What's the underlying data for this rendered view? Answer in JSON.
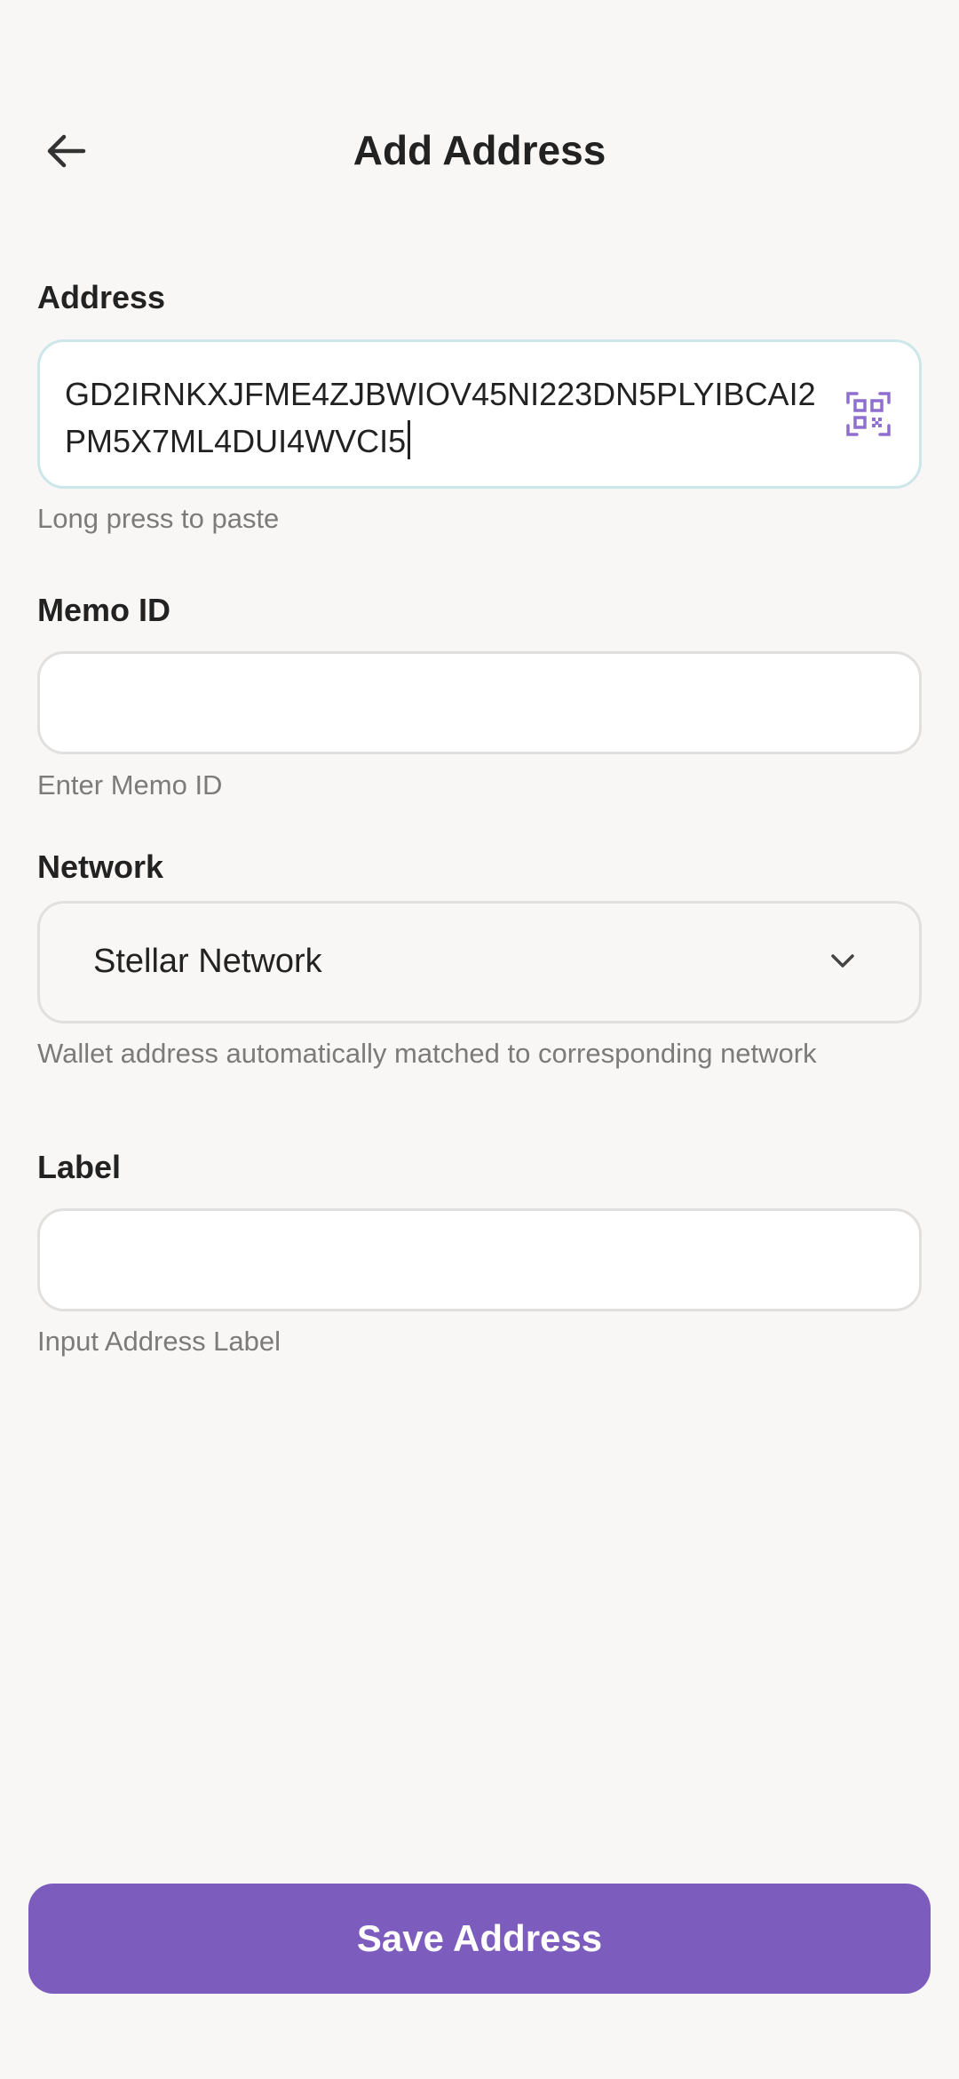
{
  "header": {
    "title": "Add Address",
    "back_icon": "arrow-left-icon"
  },
  "address": {
    "label": "Address",
    "value": "GD2IRNKXJFME4ZJBWIOV45NI223DN5PLYIBCAI2PM5X7ML4DUI4WVCI5",
    "hint": "Long press to paste",
    "scan_icon": "qr-scan-icon"
  },
  "memo": {
    "label": "Memo ID",
    "value": "",
    "hint": "Enter Memo ID"
  },
  "network": {
    "label": "Network",
    "selected": "Stellar Network",
    "hint": "Wallet address automatically matched to corresponding network",
    "dropdown_icon": "chevron-down-icon"
  },
  "label_field": {
    "label": "Label",
    "value": "",
    "hint": "Input Address Label"
  },
  "save_button": {
    "label": "Save Address"
  },
  "colors": {
    "background": "#f8f7f6",
    "accent": "#7c5cbd",
    "focused_border": "#cce6ea"
  }
}
